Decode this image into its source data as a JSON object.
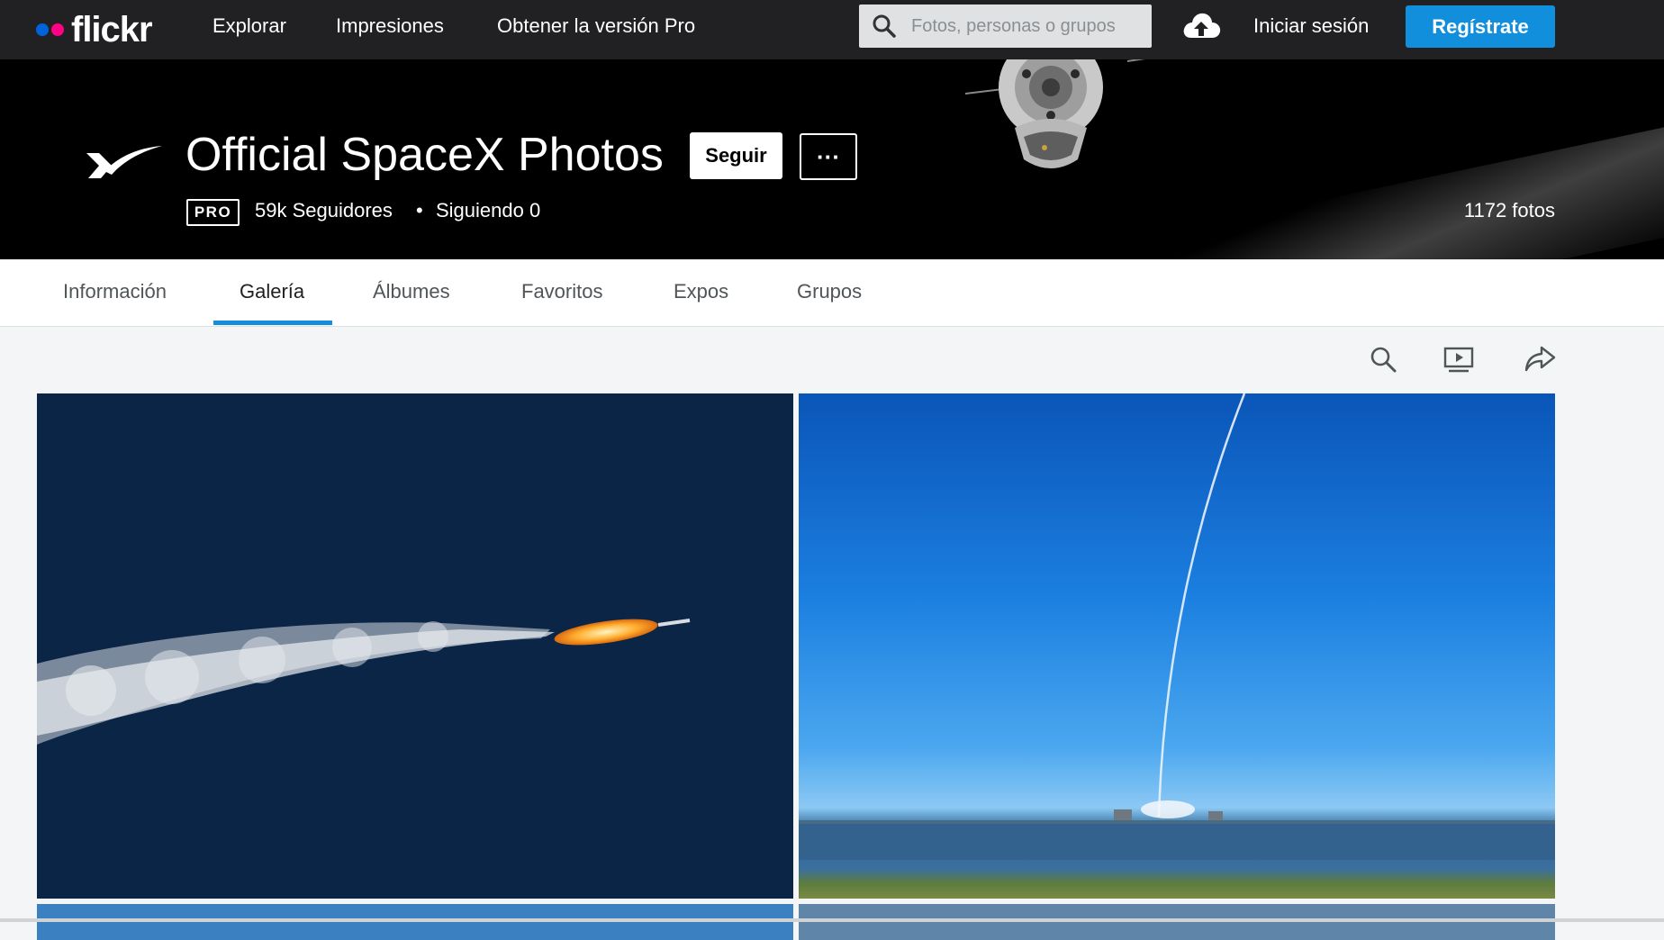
{
  "topnav": {
    "logo_text": "flickr",
    "links": [
      "Explorar",
      "Impresiones",
      "Obtener la versión Pro"
    ],
    "search_placeholder": "Fotos, personas o grupos",
    "upload_icon": "cloud-upload-icon",
    "login_label": "Iniciar sesión",
    "signup_label": "Regístrate",
    "colors": {
      "bar": "#212124",
      "signup": "#128fdc",
      "dot_blue": "#0063dc",
      "dot_pink": "#ff0084"
    }
  },
  "profile": {
    "name": "Official SpaceX Photos",
    "follow_label": "Seguir",
    "more_label": "···",
    "pro_badge": "PRO",
    "followers": "59k Seguidores",
    "bullet": "•",
    "following": "Siguiendo 0",
    "photo_count": "1172 fotos",
    "avatar_icon": "spacex-x-logo"
  },
  "tabs": {
    "items": [
      "Información",
      "Galería",
      "Álbumes",
      "Favoritos",
      "Expos",
      "Grupos"
    ],
    "active": "Galería",
    "accent": "#128fdc"
  },
  "toolbar": {
    "icons": [
      "search-icon",
      "slideshow-icon",
      "share-icon"
    ]
  },
  "gallery": {
    "photos": [
      {
        "subject": "rocket-ascent-exhaust-plume"
      },
      {
        "subject": "launch-trail-over-water"
      },
      {
        "subject": "partial-photo"
      },
      {
        "subject": "partial-photo"
      }
    ]
  }
}
